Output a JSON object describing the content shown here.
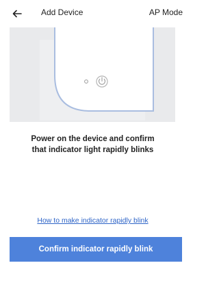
{
  "header": {
    "back_icon": "arrow-left-icon",
    "title": "Add Device",
    "mode_label": "AP Mode"
  },
  "illustration": {
    "device_icon": "power-icon",
    "background_color": "#e9eaec",
    "device_color": "#ffffff",
    "outline_color": "#a9bde0"
  },
  "instruction": {
    "line1": "Power on the device and confirm",
    "line2": "that indicator light rapidly blinks"
  },
  "help_link": {
    "label": "How to make indicator rapidly blink"
  },
  "confirm_button": {
    "label": "Confirm indicator rapidly blink",
    "color": "#4e82db"
  }
}
